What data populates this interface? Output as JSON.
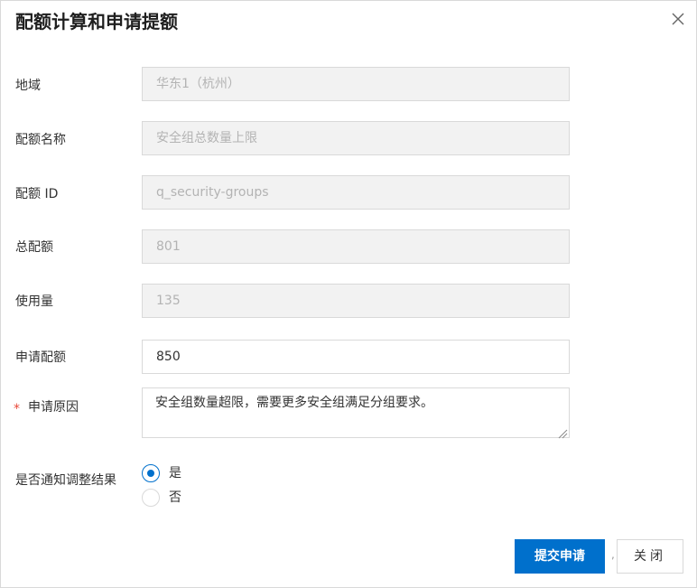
{
  "dialog": {
    "title": "配额计算和申请提额",
    "close_icon": "close-icon"
  },
  "form": {
    "region": {
      "label": "地域",
      "value": "华东1（杭州）"
    },
    "quota_name": {
      "label": "配额名称",
      "value": "安全组总数量上限"
    },
    "quota_id": {
      "label": "配额 ID",
      "value": "q_security-groups"
    },
    "total_quota": {
      "label": "总配额",
      "value": "801"
    },
    "usage": {
      "label": "使用量",
      "value": "135"
    },
    "apply_quota": {
      "label": "申请配额",
      "value": "850"
    },
    "reason": {
      "label": "申请原因",
      "required_mark": "*",
      "value": "安全组数量超限，需要更多安全组满足分组要求。"
    },
    "notify": {
      "label": "是否通知调整结果",
      "options": [
        {
          "label": "是",
          "checked": true
        },
        {
          "label": "否",
          "checked": false
        }
      ]
    }
  },
  "footer": {
    "submit_label": "提交申请",
    "separator": ",",
    "close_label": "关闭"
  },
  "colors": {
    "primary": "#0070cc",
    "required": "#e84738",
    "disabled_bg": "#f2f2f2"
  }
}
